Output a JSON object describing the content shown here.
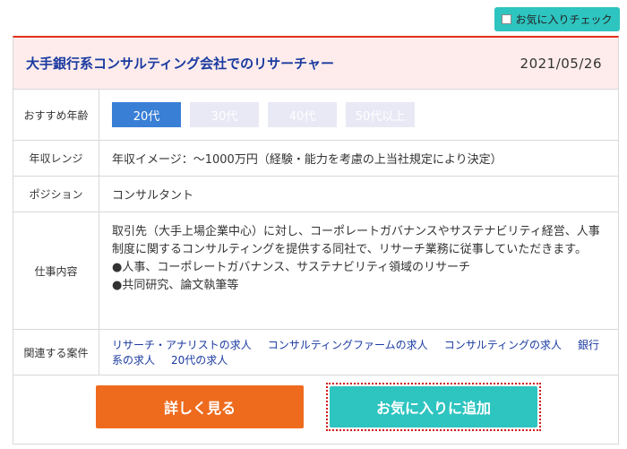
{
  "fav_check": {
    "label": "お気に入りチェック",
    "checked": false
  },
  "job": {
    "title": "大手銀行系コンサルティング会社でのリサーチャー",
    "date": "2021/05/26"
  },
  "rows": {
    "age": {
      "label": "おすすめ年齢",
      "tags": [
        {
          "text": "20代",
          "active": true
        },
        {
          "text": "30代",
          "active": false
        },
        {
          "text": "40代",
          "active": false
        },
        {
          "text": "50代以上",
          "active": false
        }
      ]
    },
    "salary": {
      "label": "年収レンジ",
      "value": "年収イメージ：〜1000万円（経験・能力を考慮の上当社規定により決定）"
    },
    "position": {
      "label": "ポジション",
      "value": "コンサルタント"
    },
    "description": {
      "label": "仕事内容",
      "text": "取引先（大手上場企業中心）に対し、コーポレートガバナンスやサステナビリティ経営、人事制度に関するコンサルティングを提供する同社で、リサーチ業務に従事していただきます。",
      "bullet1": "●人事、コーポレートガバナンス、サステナビリティ領域のリサーチ",
      "bullet2": "●共同研究、論文執筆等"
    },
    "related": {
      "label": "関連する案件",
      "links": [
        "リサーチ・アナリストの求人",
        "コンサルティングファームの求人",
        "コンサルティングの求人",
        "銀行系の求人",
        "20代の求人"
      ]
    }
  },
  "actions": {
    "detail_label": "詳しく見る",
    "favorite_label": "お気に入りに追加"
  },
  "colors": {
    "accent_teal": "#2ec4c0",
    "accent_orange": "#ee6b1e",
    "title_blue": "#1a3aa0",
    "header_bg": "#fdeceb",
    "active_tag": "#3a7fd6"
  }
}
